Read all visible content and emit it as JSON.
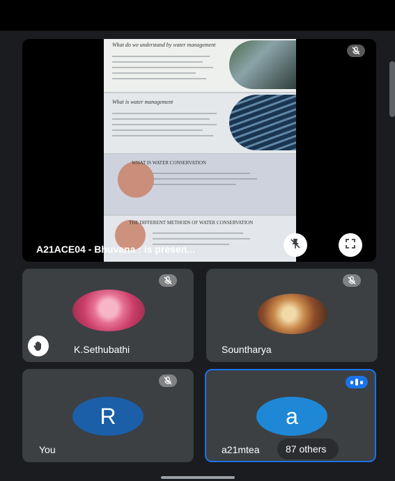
{
  "presentation": {
    "caption": "A21ACE04 - Bhuvana : is presen...",
    "slide_titles": [
      "What do we understand by water management",
      "What is water management",
      "WHAT IS WATER CONSERVATION",
      "THE DIFFERENT METHODS OF WATER CONSERVATION"
    ]
  },
  "participants": [
    {
      "name": "K.Sethubathi",
      "hand_raised": true,
      "muted": true
    },
    {
      "name": "Sountharya",
      "muted": true
    },
    {
      "name": "You",
      "avatar_letter": "R",
      "avatar_color": "#1a5fa8",
      "muted": true
    },
    {
      "name": "a21mtea",
      "avatar_letter": "a",
      "avatar_color": "#1e88d6",
      "speaking": true,
      "others_label": "87 others"
    }
  ],
  "colors": {
    "accent_border": "#1a73e8",
    "tile_bg": "#3c4043"
  }
}
